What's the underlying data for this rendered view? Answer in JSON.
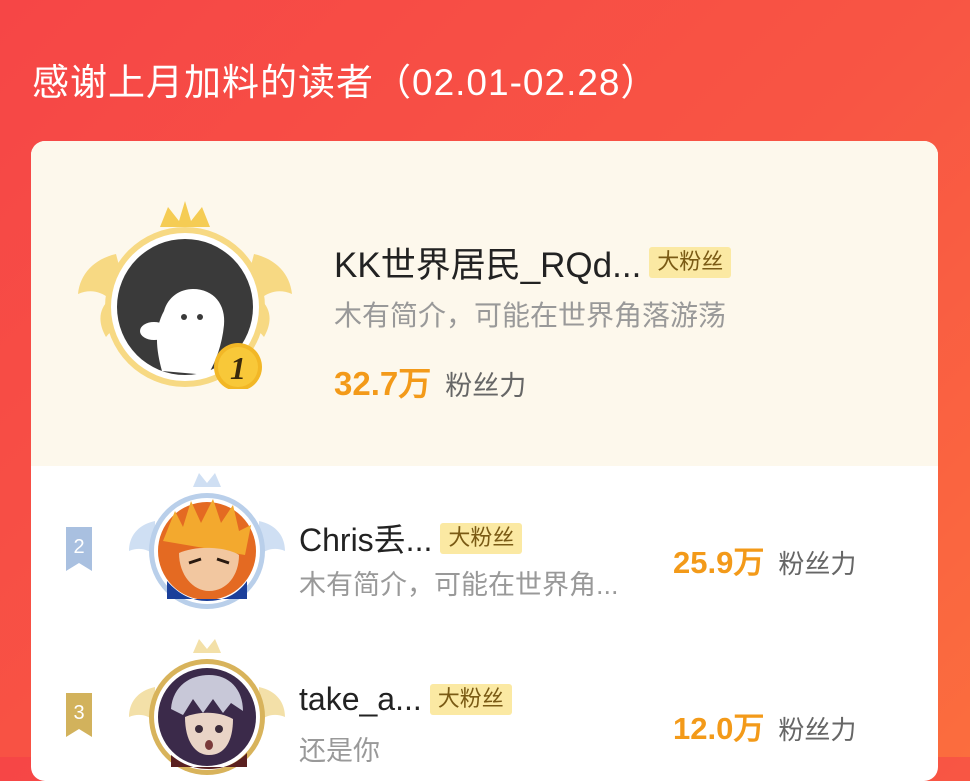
{
  "header": {
    "title": "感谢上月加料的读者（02.01-02.28）"
  },
  "top_reader": {
    "rank": "1",
    "name": "KK世界居民_RQd...",
    "badge": "大粉丝",
    "bio": "木有简介，可能在世界角落游荡",
    "fans_value": "32.7万",
    "fans_label": "粉丝力"
  },
  "readers": [
    {
      "rank": "2",
      "name": "Chris丢...",
      "badge": "大粉丝",
      "bio": "木有简介，可能在世界角...",
      "fans_value": "25.9万",
      "fans_label": "粉丝力"
    },
    {
      "rank": "3",
      "name": "take_a...",
      "badge": "大粉丝",
      "bio": "还是你",
      "fans_value": "12.0万",
      "fans_label": "粉丝力"
    }
  ],
  "colors": {
    "background_red": "#f64646",
    "gold": "#f39a19",
    "badge_bg": "#fbe9a3",
    "silver": "#a9c0e0",
    "bronze": "#d2b25c"
  },
  "icons": [
    "crown-icon",
    "wing-icon",
    "default-avatar-icon",
    "rank-medal-icon"
  ]
}
